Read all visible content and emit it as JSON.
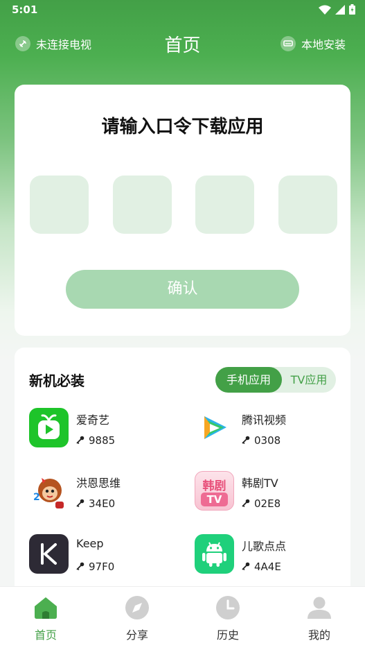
{
  "status_bar": {
    "time": "5:01"
  },
  "header": {
    "left_label": "未连接电视",
    "title": "首页",
    "right_label": "本地安装"
  },
  "code_card": {
    "title": "请输入口令下载应用",
    "confirm_label": "确认"
  },
  "apps": {
    "title": "新机必装",
    "tabs": [
      {
        "label": "手机应用",
        "active": true
      },
      {
        "label": "TV应用",
        "active": false
      }
    ],
    "items": [
      {
        "name": "爱奇艺",
        "code": "9885",
        "icon": "iqiyi-icon"
      },
      {
        "name": "腾讯视频",
        "code": "0308",
        "icon": "tencent-video-icon"
      },
      {
        "name": "洪恩思维",
        "code": "34E0",
        "icon": "hongen-icon"
      },
      {
        "name": "韩剧TV",
        "code": "02E8",
        "icon": "hanju-tv-icon",
        "icon_text_top": "韩剧",
        "icon_text_bottom": "TV"
      },
      {
        "name": "Keep",
        "code": "97F0",
        "icon": "keep-icon"
      },
      {
        "name": "儿歌点点",
        "code": "4A4E",
        "icon": "android-icon"
      }
    ]
  },
  "bottom_nav": [
    {
      "label": "首页",
      "icon": "home-icon",
      "active": true
    },
    {
      "label": "分享",
      "icon": "compass-icon",
      "active": false
    },
    {
      "label": "历史",
      "icon": "clock-icon",
      "active": false
    },
    {
      "label": "我的",
      "icon": "user-icon",
      "active": false
    }
  ],
  "colors": {
    "primary": "#43a047",
    "light_green": "#e1f0e3",
    "button_disabled": "#a8d8b1"
  }
}
